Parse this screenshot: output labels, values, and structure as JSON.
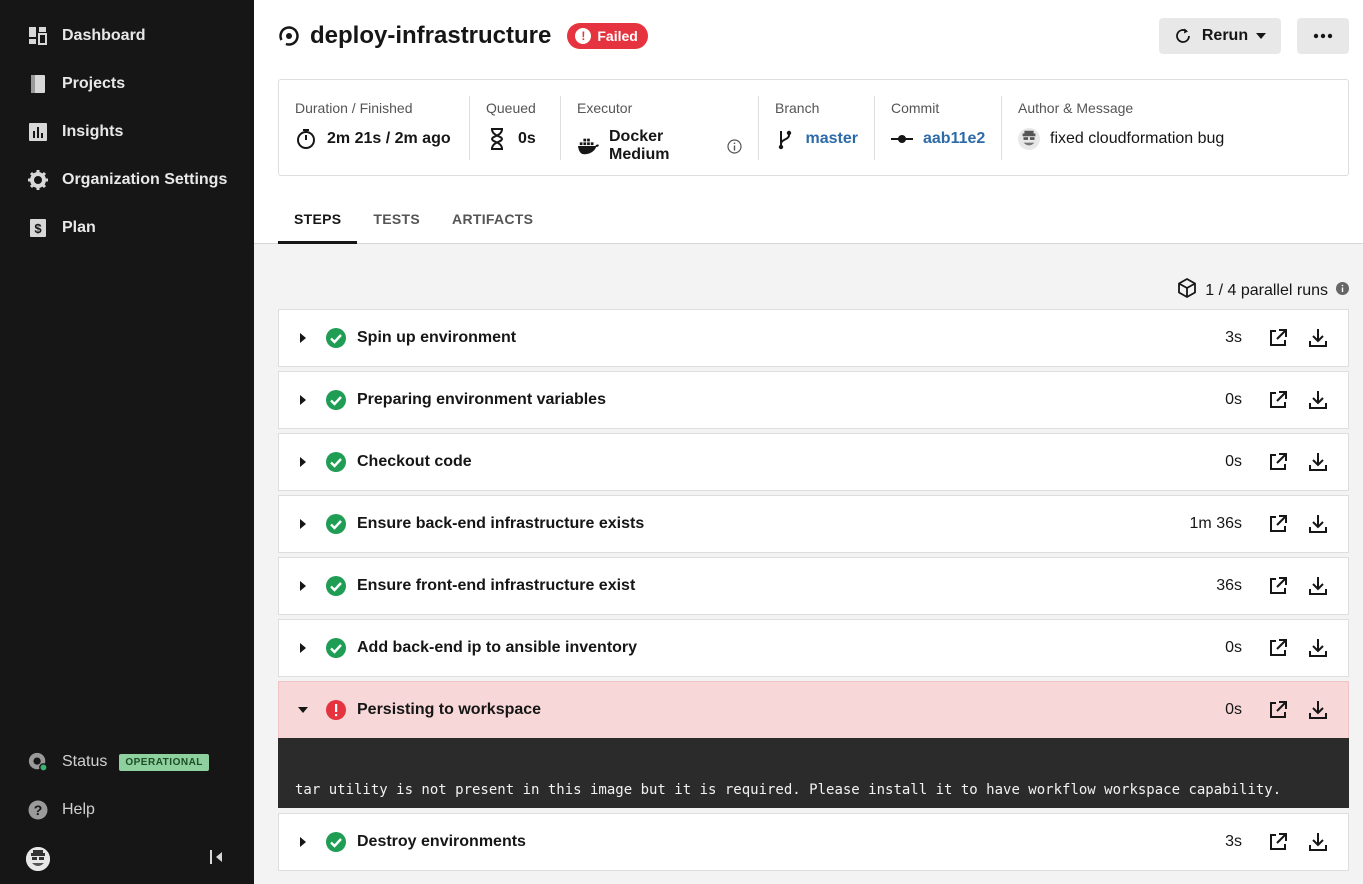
{
  "sidebar": {
    "items": [
      {
        "label": "Dashboard",
        "icon": "dashboard-icon"
      },
      {
        "label": "Projects",
        "icon": "projects-icon"
      },
      {
        "label": "Insights",
        "icon": "insights-icon"
      },
      {
        "label": "Organization Settings",
        "icon": "gear-icon"
      },
      {
        "label": "Plan",
        "icon": "dollar-icon"
      }
    ],
    "status_label": "Status",
    "status_badge": "OPERATIONAL",
    "help_label": "Help"
  },
  "header": {
    "title": "deploy-infrastructure",
    "status": "Failed",
    "rerun_label": "Rerun",
    "status_color": "#e5343f"
  },
  "info": {
    "duration": {
      "label": "Duration / Finished",
      "value": "2m 21s / 2m ago"
    },
    "queued": {
      "label": "Queued",
      "value": "0s"
    },
    "executor": {
      "label": "Executor",
      "value": "Docker Medium"
    },
    "branch": {
      "label": "Branch",
      "value": "master"
    },
    "commit": {
      "label": "Commit",
      "value": "aab11e2"
    },
    "author": {
      "label": "Author & Message",
      "value": "fixed cloudformation bug"
    }
  },
  "tabs": [
    "STEPS",
    "TESTS",
    "ARTIFACTS"
  ],
  "parallel_runs": "1 / 4 parallel runs",
  "steps": [
    {
      "name": "Spin up environment",
      "duration": "3s",
      "status": "success"
    },
    {
      "name": "Preparing environment variables",
      "duration": "0s",
      "status": "success"
    },
    {
      "name": "Checkout code",
      "duration": "0s",
      "status": "success"
    },
    {
      "name": "Ensure back-end infrastructure exists",
      "duration": "1m 36s",
      "status": "success"
    },
    {
      "name": "Ensure front-end infrastructure exist",
      "duration": "36s",
      "status": "success"
    },
    {
      "name": "Add back-end ip to ansible inventory",
      "duration": "0s",
      "status": "success"
    },
    {
      "name": "Persisting to workspace",
      "duration": "0s",
      "status": "failed"
    },
    {
      "name": "Destroy environments",
      "duration": "3s",
      "status": "success"
    }
  ],
  "console_output": "tar utility is not present in this image but it is required. Please install it to have workflow workspace capability.",
  "colors": {
    "success": "#1f9d55",
    "failed": "#e5343f",
    "link": "#2d6ba8"
  }
}
